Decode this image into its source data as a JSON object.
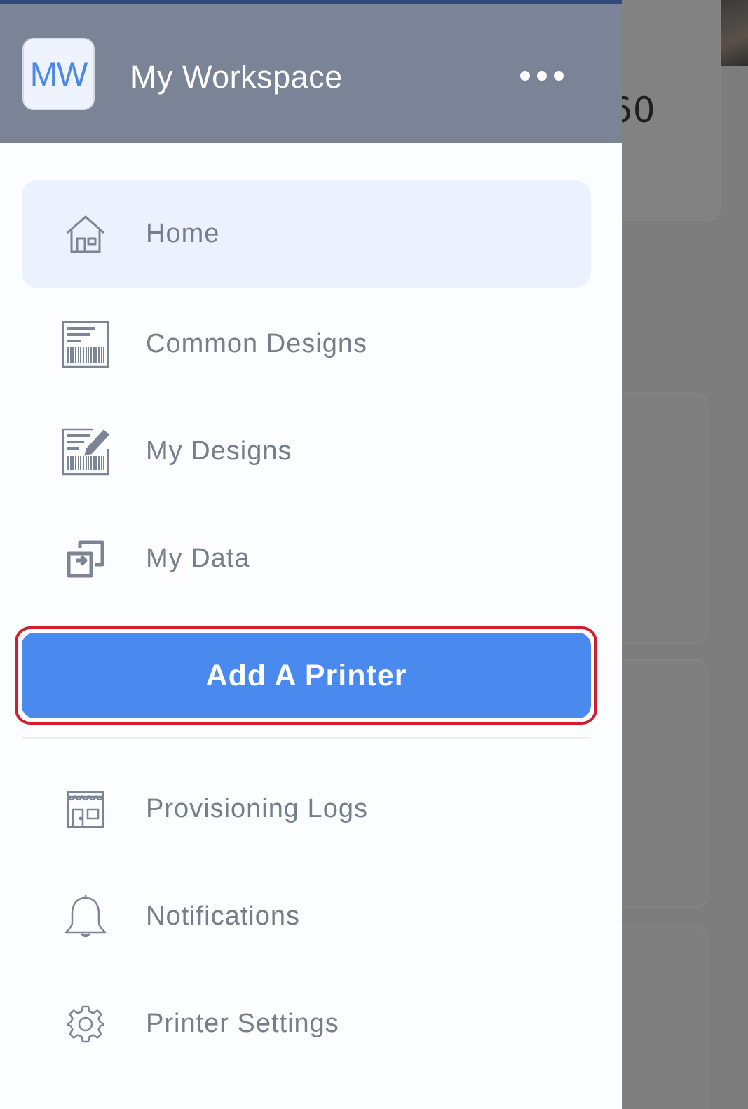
{
  "background": {
    "partial_number": "60"
  },
  "header": {
    "avatar_initials": "MW",
    "title": "My Workspace",
    "more_icon": "more-horizontal-icon"
  },
  "nav": {
    "items": [
      {
        "label": "Home",
        "icon": "home-icon",
        "active": true
      },
      {
        "label": "Common Designs",
        "icon": "barcode-label-icon",
        "active": false
      },
      {
        "label": "My Designs",
        "icon": "barcode-edit-icon",
        "active": false
      },
      {
        "label": "My Data",
        "icon": "data-sync-icon",
        "active": false
      }
    ],
    "secondary_items": [
      {
        "label": "Provisioning Logs",
        "icon": "storefront-icon"
      },
      {
        "label": "Notifications",
        "icon": "bell-icon"
      },
      {
        "label": "Printer Settings",
        "icon": "gear-icon"
      }
    ]
  },
  "add_printer": {
    "label": "Add A Printer"
  },
  "colors": {
    "header_bg": "#7b8496",
    "accent": "#4a89ee",
    "highlight_outline": "#d11d2d",
    "active_item_bg": "#ecf2fd",
    "nav_text": "#757f8c"
  }
}
